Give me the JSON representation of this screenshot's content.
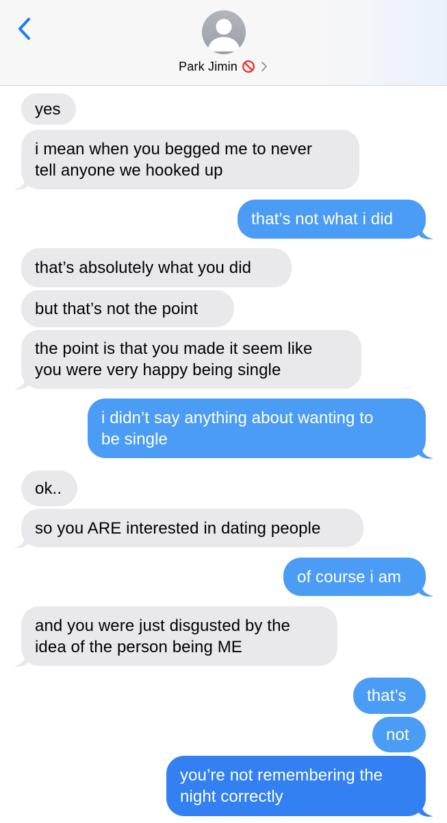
{
  "header": {
    "contact_name": "Park Jimin",
    "icons": {
      "back": "chevron-left-icon",
      "avatar": "person-silhouette-icon",
      "blocked": "prohibited-icon",
      "disclosure": "chevron-right-icon"
    }
  },
  "colors": {
    "incoming_bubble": "#e9e9eb",
    "outgoing_bubble": "#4b9cf4",
    "outgoing_bubble_last": "#3280f1",
    "accent": "#1a7cf5",
    "blocked_red": "#e6372c"
  },
  "messages": [
    {
      "from": "them",
      "text": "yes"
    },
    {
      "from": "them",
      "text": "i mean when you begged me to never\ntell anyone we hooked up"
    },
    {
      "from": "me",
      "text": "that’s not what i did"
    },
    {
      "from": "them",
      "text": "that’s absolutely what you did"
    },
    {
      "from": "them",
      "text": "but that’s not the point"
    },
    {
      "from": "them",
      "text": "the point is that you made it seem like\nyou were very happy being single"
    },
    {
      "from": "me",
      "text": "i didn’t say anything about wanting to\nbe single"
    },
    {
      "from": "them",
      "text": "ok.."
    },
    {
      "from": "them",
      "text": "so you ARE interested in dating people"
    },
    {
      "from": "me",
      "text": "of course i am"
    },
    {
      "from": "them",
      "text": "and you were just disgusted by the\nidea of the person being ME"
    },
    {
      "from": "me",
      "text": "that’s"
    },
    {
      "from": "me",
      "text": "not"
    },
    {
      "from": "me",
      "text": "you’re not remembering the\nnight correctly"
    }
  ]
}
